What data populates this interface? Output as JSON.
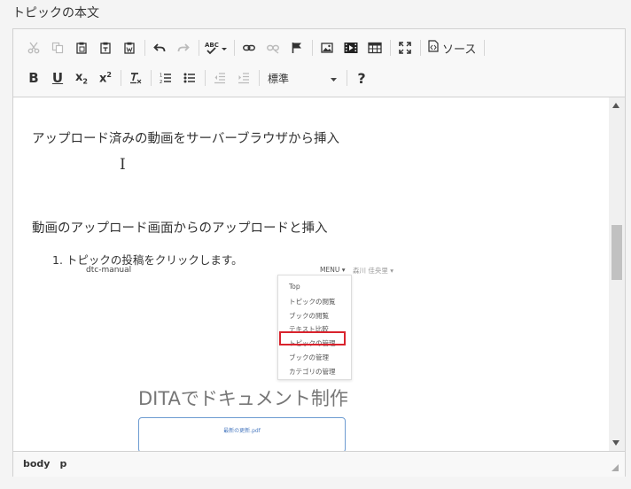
{
  "field_label": "トピックの本文",
  "toolbar": {
    "row1": [
      {
        "name": "cut-button",
        "icon": "cut-icon",
        "title": "切り取り",
        "disabled": true
      },
      {
        "name": "copy-button",
        "icon": "copy-icon",
        "title": "コピー",
        "disabled": true
      },
      {
        "name": "paste-button",
        "icon": "paste-icon",
        "title": "貼り付け",
        "disabled": false
      },
      {
        "name": "paste-text-button",
        "icon": "paste-text-icon",
        "title": "プレーンテキスト貼り付け",
        "disabled": false
      },
      {
        "name": "paste-word-button",
        "icon": "paste-word-icon",
        "title": "ワード文章から貼り付け",
        "disabled": false
      },
      {
        "name": "undo-button",
        "icon": "undo-icon",
        "title": "元に戻す",
        "disabled": false
      },
      {
        "name": "redo-button",
        "icon": "redo-icon",
        "title": "やり直し",
        "disabled": true
      },
      {
        "name": "spellcheck-button",
        "icon": "spellcheck-icon",
        "title": "スペルチェック",
        "disabled": false
      },
      {
        "name": "link-button",
        "icon": "link-icon",
        "title": "リンク挿入/編集",
        "disabled": false
      },
      {
        "name": "unlink-button",
        "icon": "unlink-icon",
        "title": "リンクを削除",
        "disabled": true
      },
      {
        "name": "anchor-button",
        "icon": "flag-icon",
        "title": "アンカー挿入/編集",
        "disabled": false
      },
      {
        "name": "image-button",
        "icon": "image-icon",
        "title": "イメージ",
        "disabled": false
      },
      {
        "name": "video-button",
        "icon": "video-icon",
        "title": "動画",
        "disabled": false
      },
      {
        "name": "table-button",
        "icon": "table-icon",
        "title": "表",
        "disabled": false
      },
      {
        "name": "maximize-button",
        "icon": "maximize-icon",
        "title": "最大化",
        "disabled": false
      }
    ],
    "source_label": "ソース",
    "row2": [
      {
        "name": "bold-button",
        "icon": "bold-icon",
        "title": "太字",
        "disabled": false
      },
      {
        "name": "underline-button",
        "icon": "underline-icon",
        "title": "下線",
        "disabled": false
      },
      {
        "name": "subscript-button",
        "icon": "subscript-icon",
        "title": "下付き",
        "disabled": false
      },
      {
        "name": "superscript-button",
        "icon": "superscript-icon",
        "title": "上付き",
        "disabled": false
      },
      {
        "name": "remove-format-button",
        "icon": "remove-format-icon",
        "title": "書式を解除",
        "disabled": false
      },
      {
        "name": "numbered-list-button",
        "icon": "numbered-list-icon",
        "title": "段落番号",
        "disabled": false
      },
      {
        "name": "bulleted-list-button",
        "icon": "bulleted-list-icon",
        "title": "箇条書き",
        "disabled": false
      },
      {
        "name": "outdent-button",
        "icon": "outdent-icon",
        "title": "インデント解除",
        "disabled": true
      },
      {
        "name": "indent-button",
        "icon": "indent-icon",
        "title": "インデント",
        "disabled": true
      }
    ],
    "format_value": "標準",
    "help_label": "?"
  },
  "content": {
    "para1": "アップロード済みの動画をサーバーブラウザから挿入",
    "para2": "動画のアップロード画面からのアップロードと挿入",
    "list_item": "1. トピックの投稿をクリックします。",
    "screenshot": {
      "site_name": "dtc-manual",
      "menu_label": "MENU ▾",
      "user_label": "森川 佳央里 ▾",
      "menu_items": [
        "Top",
        "トピックの閲覧",
        "ブックの閲覧",
        "テキスト比較",
        "トピックの管理",
        "ブックの管理",
        "カテゴリの管理"
      ],
      "highlighted_item": "トピックの管理",
      "big_title": "DITAでドキュメント制作",
      "box_text": "最新の更新.pdf"
    }
  },
  "statusbar": {
    "path": [
      "body",
      "p"
    ]
  }
}
